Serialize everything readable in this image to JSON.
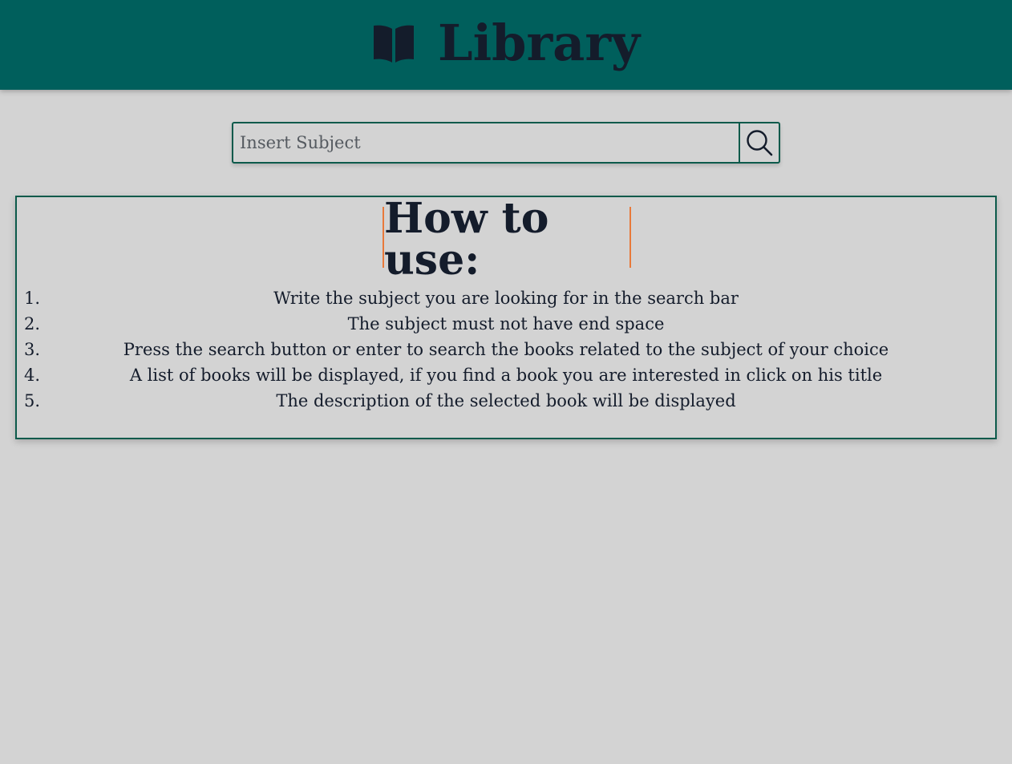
{
  "header": {
    "title": "Library",
    "icon": "open-book-icon",
    "background_color": "#005f5c"
  },
  "search": {
    "placeholder": "Insert Subject",
    "value": "",
    "button_icon": "search-icon"
  },
  "instructions": {
    "title": "How to use:",
    "accent_color": "#e8793a",
    "steps": [
      {
        "number": "1.",
        "text": "Write the subject you are looking for in the search bar"
      },
      {
        "number": "2.",
        "text": "The subject must not have end space"
      },
      {
        "number": "3.",
        "text": "Press the search button or enter to search the books related to the subject of your choice"
      },
      {
        "number": "4.",
        "text": "A list of books will be displayed, if you find a book you are interested in click on his title"
      },
      {
        "number": "5.",
        "text": "The description of the selected book will be displayed"
      }
    ]
  }
}
